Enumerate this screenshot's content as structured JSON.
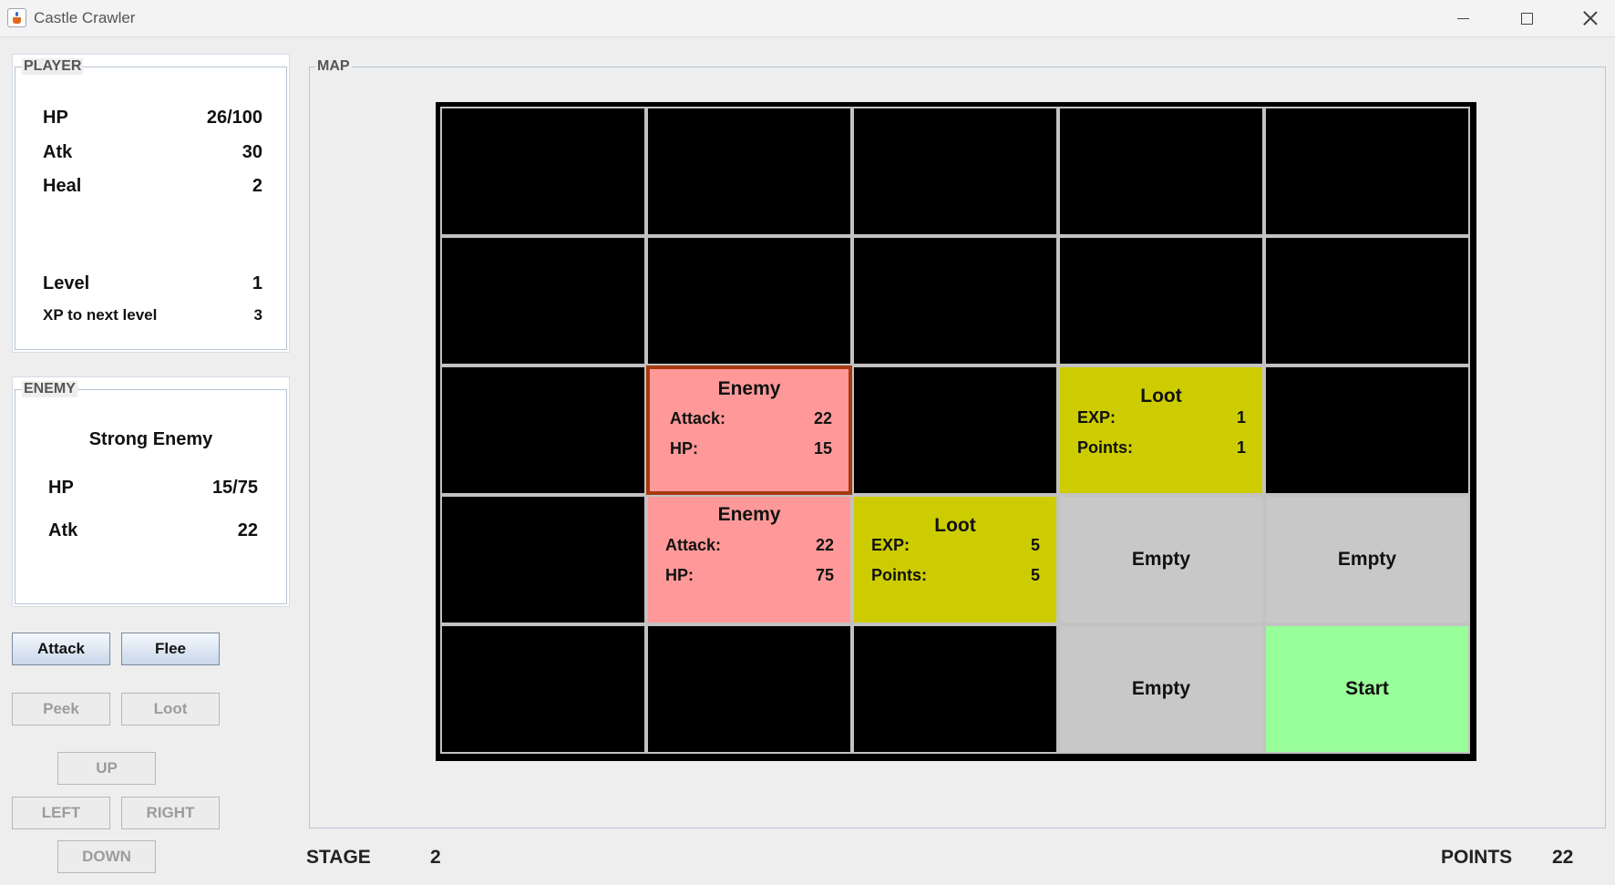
{
  "window": {
    "title": "Castle Crawler"
  },
  "player": {
    "legend": "PLAYER",
    "hp_label": "HP",
    "hp_value": "26/100",
    "atk_label": "Atk",
    "atk_value": "30",
    "heal_label": "Heal",
    "heal_value": "2",
    "level_label": "Level",
    "level_value": "1",
    "xp_label": "XP to next level",
    "xp_value": "3"
  },
  "enemy": {
    "legend": "ENEMY",
    "name": "Strong Enemy",
    "hp_label": "HP",
    "hp_value": "15/75",
    "atk_label": "Atk",
    "atk_value": "22"
  },
  "buttons": {
    "attack": "Attack",
    "flee": "Flee",
    "peek": "Peek",
    "loot": "Loot",
    "up": "UP",
    "left": "LEFT",
    "right": "RIGHT",
    "down": "DOWN"
  },
  "map": {
    "legend": "MAP",
    "cells": {
      "r2c1": {
        "title": "Enemy",
        "k1": "Attack:",
        "v1": "22",
        "k2": "HP:",
        "v2": "15"
      },
      "r2c3": {
        "title": "Loot",
        "k1": "EXP:",
        "v1": "1",
        "k2": "Points:",
        "v2": "1"
      },
      "r3c1": {
        "title": "Enemy",
        "k1": "Attack:",
        "v1": "22",
        "k2": "HP:",
        "v2": "75"
      },
      "r3c2": {
        "title": "Loot",
        "k1": "EXP:",
        "v1": "5",
        "k2": "Points:",
        "v2": "5"
      },
      "r3c3": {
        "label": "Empty"
      },
      "r3c4": {
        "label": "Empty"
      },
      "r4c3": {
        "label": "Empty"
      },
      "r4c4": {
        "label": "Start"
      }
    }
  },
  "footer": {
    "stage_label": "STAGE",
    "stage_value": "2",
    "points_label": "POINTS",
    "points_value": "22"
  },
  "colors": {
    "enemy": "#ff9999",
    "loot": "#cccc00",
    "empty": "#c8c8c8",
    "start": "#99ff99",
    "unexplored": "#000000",
    "selected_border": "#a63a0e"
  }
}
